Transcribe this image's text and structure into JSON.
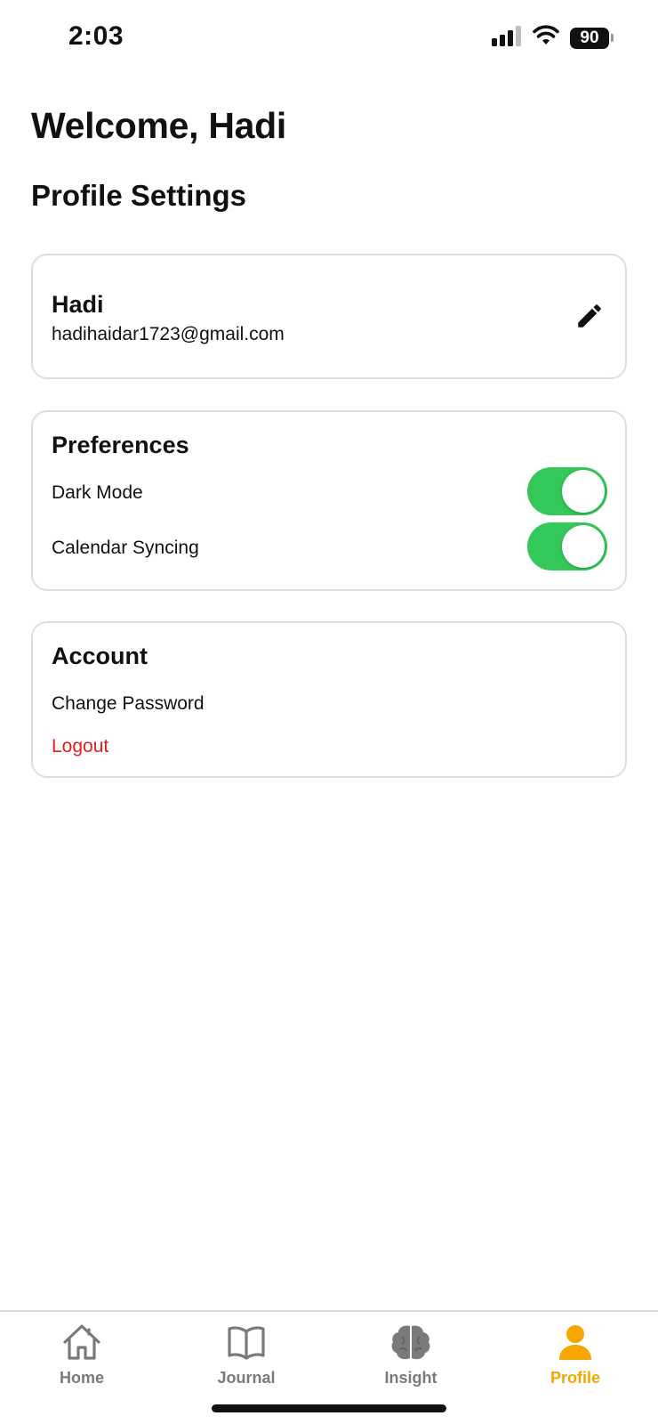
{
  "status_bar": {
    "time": "2:03",
    "battery_level": "90",
    "icons": [
      "cellular-signal-icon",
      "wifi-icon",
      "battery-icon"
    ]
  },
  "header": {
    "welcome": "Welcome, Hadi",
    "section_title": "Profile Settings"
  },
  "profile_card": {
    "name": "Hadi",
    "email": "hadihaidar1723@gmail.com",
    "edit_icon": "pencil-icon"
  },
  "preferences": {
    "heading": "Preferences",
    "items": [
      {
        "label": "Dark Mode",
        "enabled": true
      },
      {
        "label": "Calendar Syncing",
        "enabled": true
      }
    ]
  },
  "account": {
    "heading": "Account",
    "change_password": "Change Password",
    "logout": "Logout"
  },
  "tab_bar": {
    "tabs": [
      {
        "label": "Home",
        "icon": "house-icon",
        "active": false
      },
      {
        "label": "Journal",
        "icon": "book-icon",
        "active": false
      },
      {
        "label": "Insight",
        "icon": "brain-icon",
        "active": false
      },
      {
        "label": "Profile",
        "icon": "person-icon",
        "active": true
      }
    ]
  },
  "colors": {
    "accent": "#f7a501",
    "toggle_on": "#34c759",
    "danger": "#e11d1d",
    "inactive_tab": "#7a7a7a",
    "card_border": "#dedede"
  }
}
